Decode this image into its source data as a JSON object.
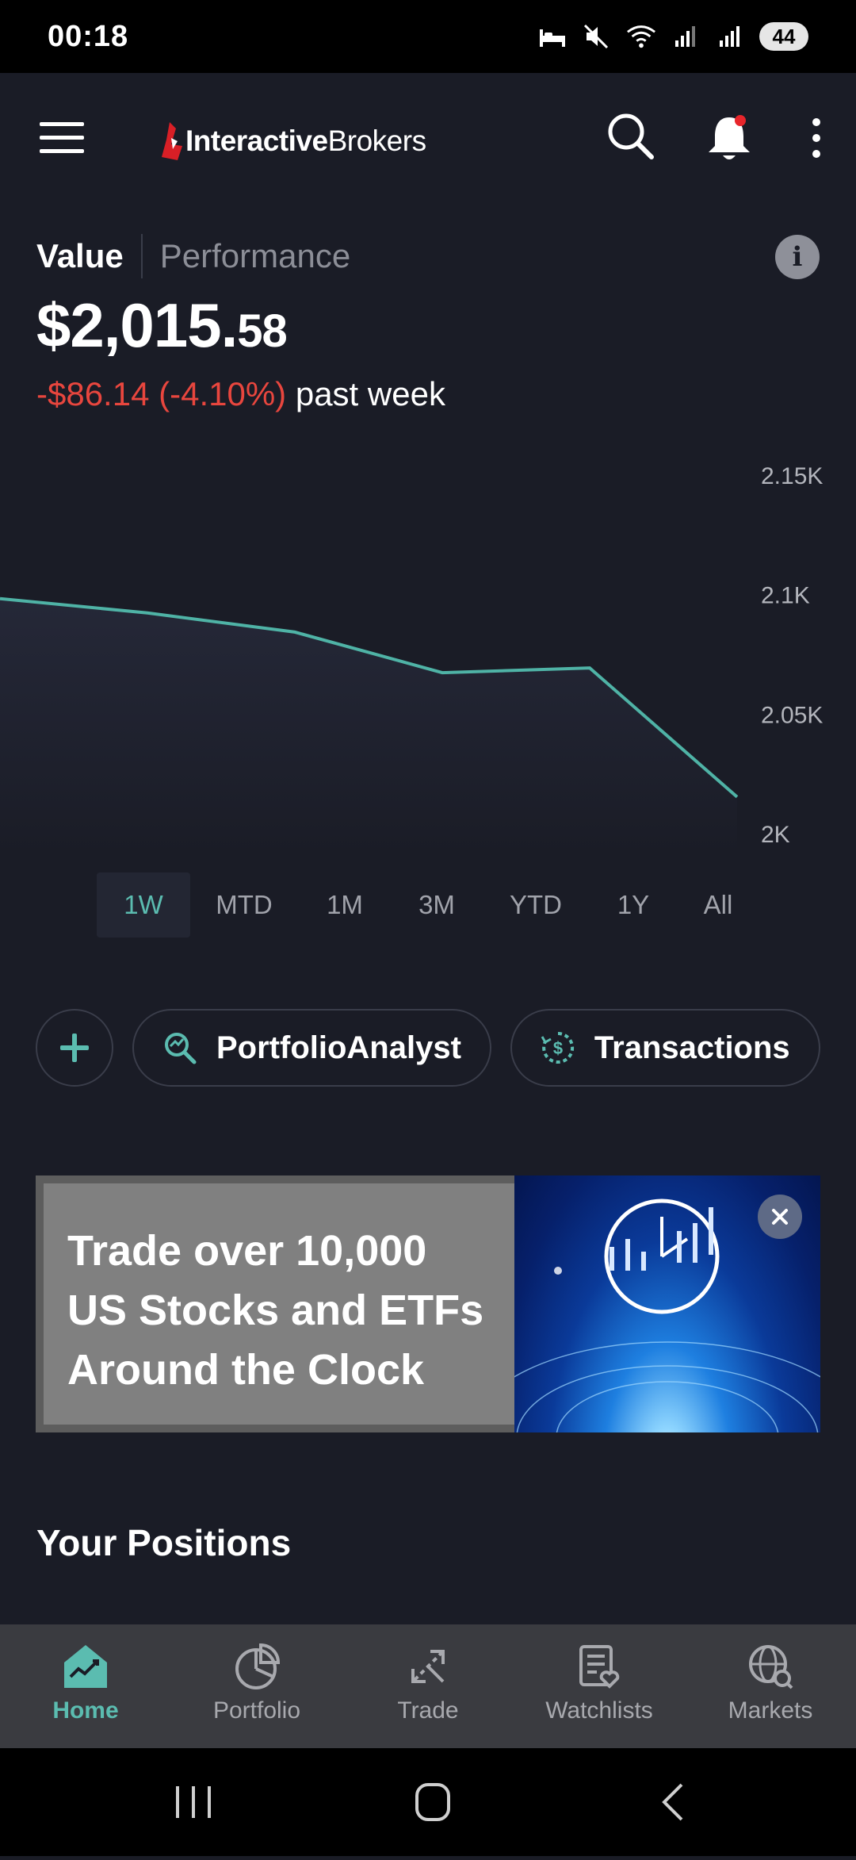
{
  "status": {
    "time": "00:18",
    "battery": "44"
  },
  "appbar": {
    "logo_part1": "Interactive",
    "logo_part2": "Brokers"
  },
  "account": {
    "tab_value": "Value",
    "tab_performance": "Performance",
    "value_main": "$2,015.",
    "value_cents": "58",
    "change": "-$86.14 (-4.10%)",
    "change_period": "past week"
  },
  "chart_data": {
    "type": "area",
    "x": [
      "1",
      "2",
      "3",
      "4",
      "5",
      "6"
    ],
    "values": [
      2098,
      2092,
      2084,
      2067,
      2069,
      2015
    ],
    "ylim": [
      2000,
      2150
    ],
    "y_ticks": [
      "2.15K",
      "2.1K",
      "2.05K",
      "2K"
    ],
    "y_tick_values": [
      2150,
      2100,
      2050,
      2000
    ],
    "line_color": "#4fb3a6",
    "grid": false
  },
  "ranges": {
    "items": [
      "1W",
      "MTD",
      "1M",
      "3M",
      "YTD",
      "1Y",
      "All"
    ],
    "active": "1W"
  },
  "actions": {
    "portfolio_analyst": "PortfolioAnalyst",
    "transactions": "Transactions"
  },
  "banner": {
    "line1": "Trade over 10,000",
    "line2": "US Stocks and ETFs",
    "line3": "Around the Clock"
  },
  "positions": {
    "title": "Your Positions"
  },
  "nav": {
    "home": "Home",
    "portfolio": "Portfolio",
    "trade": "Trade",
    "watchlists": "Watchlists",
    "markets": "Markets"
  },
  "colors": {
    "accent": "#5bbcb0",
    "negative": "#e8463e",
    "background": "#1a1c26",
    "brand_red": "#d81f26"
  }
}
